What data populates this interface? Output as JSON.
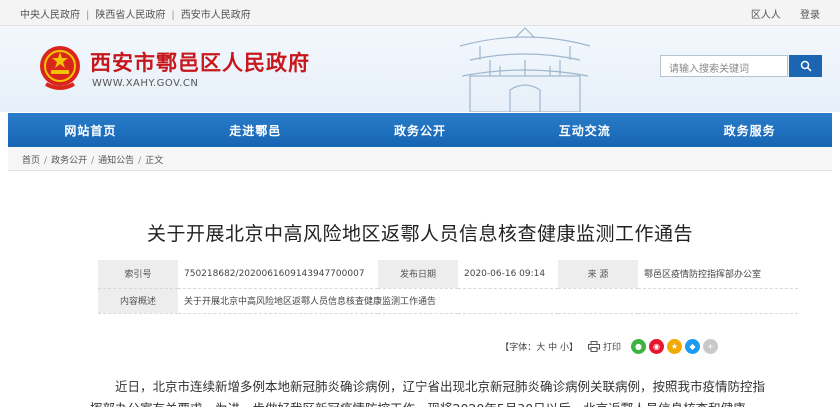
{
  "topbar": {
    "link1": "中央人民政府",
    "link2": "陕西省人民政府",
    "link3": "西安市人民政府",
    "right1": "区人人",
    "right2": "登录"
  },
  "header": {
    "title": "西安市鄠邑区人民政府",
    "url": "WWW.XAHY.GOV.CN",
    "search_placeholder": "请输入搜索关键词"
  },
  "nav": {
    "items": [
      "网站首页",
      "走进鄠邑",
      "政务公开",
      "互动交流",
      "政务服务"
    ]
  },
  "breadcrumb": {
    "items": [
      "首页",
      "政务公开",
      "通知公告",
      "正文"
    ]
  },
  "article": {
    "title": "关于开展北京中高风险地区返鄠人员信息核查健康监测工作通告",
    "meta": {
      "index_label": "索引号",
      "index_value": "750218682/2020061609143947700007",
      "date_label": "发布日期",
      "date_value": "2020-06-16 09:14",
      "source_label": "来 源",
      "source_value": "鄠邑区疫情防控指挥部办公室",
      "summary_label": "内容概述",
      "summary_value": "关于开展北京中高风险地区返鄠人员信息核查健康监测工作通告"
    },
    "tools": {
      "font": "【字体：大 中 小】",
      "print": "打印"
    },
    "body": "近日，北京市连续新增多例本地新冠肺炎确诊病例，辽宁省出现北京新冠肺炎确诊病例关联病例，按照我市疫情防控指挥部办公室有关要求，为进一步做好我区新冠疫情防控工作，现将2020年5月30日以后，北京返鄠人员信息核查和健康"
  }
}
